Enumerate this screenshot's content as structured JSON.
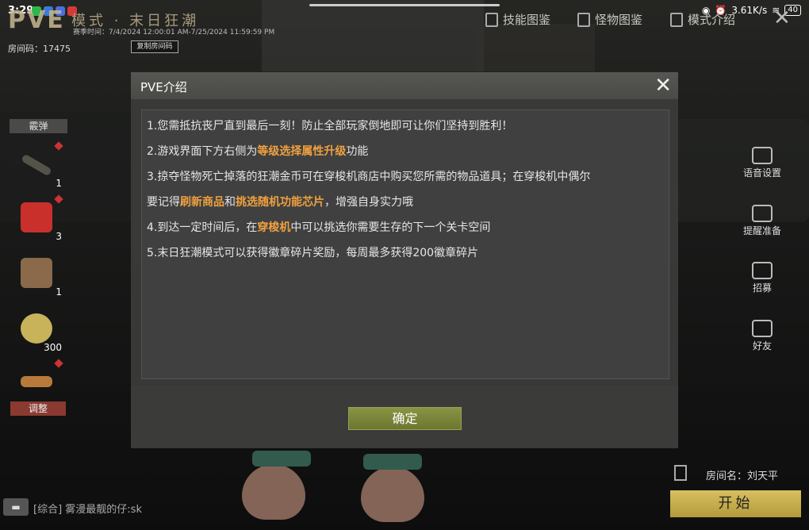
{
  "status_bar": {
    "time": "3:29",
    "net_speed": "3.61K/s",
    "battery": "40",
    "app_icons": [
      {
        "name": "green-app-icon",
        "color": "#2db84d"
      },
      {
        "name": "blue-app-icon",
        "color": "#3a7bd5"
      },
      {
        "name": "blue-app-icon-2",
        "color": "#4a6fe0"
      },
      {
        "name": "red-app-icon",
        "color": "#d33a3a"
      }
    ]
  },
  "mode": {
    "pve_label": "PVE",
    "subtitle": "模式 · 末日狂潮",
    "season": "赛季时间：7/4/2024 12:00:01 AM-7/25/2024 11:59:59 PM",
    "room_code_label": "房间码：17475",
    "copy_button": "复制房间码"
  },
  "top_nav": {
    "skills": "技能图鉴",
    "monsters": "怪物图鉴",
    "mode_intro": "模式介绍"
  },
  "inventory": {
    "header": "霰弹",
    "slots": [
      {
        "name": "weapon",
        "count": "1"
      },
      {
        "name": "medkit",
        "count": "3"
      },
      {
        "name": "grenade",
        "count": "1"
      },
      {
        "name": "coin",
        "count": "300"
      },
      {
        "name": "ammo",
        "count": ""
      }
    ],
    "adjust_button": "调整"
  },
  "side_actions": {
    "voice": "语音设置",
    "remind": "提醒准备",
    "recruit": "招募",
    "friends": "好友"
  },
  "bottom": {
    "chat_channel": "[综合]",
    "chat_message": "雾漫最靓的仔:sk",
    "room_name": "房间名：刘天平",
    "start_button": "开始"
  },
  "dialog": {
    "title": "PVE介绍",
    "line1": "1.您需抵抗丧尸直到最后一刻！防止全部玩家倒地即可让你们坚持到胜利！",
    "line2_pre": "2.游戏界面下方右侧为",
    "line2_hl": "等级选择属性升级",
    "line2_post": "功能",
    "line3": "3.掠夺怪物死亡掉落的狂潮金币可在穿梭机商店中购买您所需的物品道具；在穿梭机中偶尔",
    "line4_pre": "要记得",
    "line4_hl1": "刷新商品",
    "line4_mid": "和",
    "line4_hl2": "挑选随机功能芯片",
    "line4_post": "，增强自身实力哦",
    "line5_pre": "4.到达一定时间后，在",
    "line5_hl": "穿梭机",
    "line5_post": "中可以挑选你需要生存的下一个关卡空间",
    "line6": "5.末日狂潮模式可以获得徽章碎片奖励，每周最多获得200徽章碎片",
    "ok_button": "确定"
  }
}
